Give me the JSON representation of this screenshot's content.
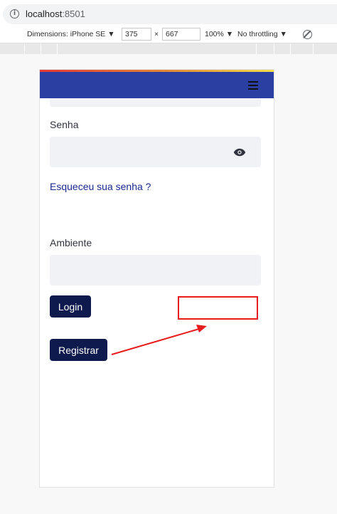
{
  "browser": {
    "url_host": "localhost",
    "url_port": ":8501"
  },
  "devtools": {
    "dimensions_label": "Dimensions: iPhone SE ▼",
    "width": "375",
    "times": "×",
    "height": "667",
    "zoom": "100% ▼",
    "throttling": "No throttling ▼"
  },
  "app": {
    "password_label": "Senha",
    "password_value": "",
    "forgot_link": "Esqueceu sua senha ?",
    "environment_label": "Ambiente",
    "environment_value": "",
    "login_button": "Login",
    "register_button": "Registrar"
  },
  "icons": [
    "info-icon",
    "rotate-icon",
    "hamburger-menu-icon",
    "eye-icon"
  ],
  "colors": {
    "navbar": "#2b3fa3",
    "button": "#0e1a4e",
    "annotation": "#e81c1c"
  }
}
